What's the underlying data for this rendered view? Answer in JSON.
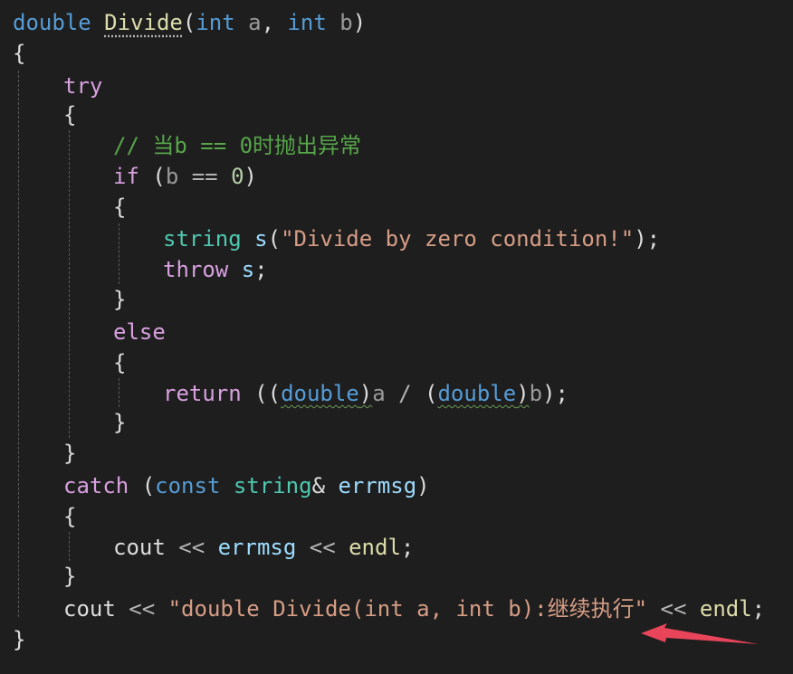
{
  "editor": {
    "code_lines": [
      [
        {
          "t": "double",
          "c": "kw"
        },
        {
          "t": " ",
          "c": "plain"
        },
        {
          "t": "Divide",
          "c": "fn",
          "u": "dotted"
        },
        {
          "t": "(",
          "c": "plain"
        },
        {
          "t": "int",
          "c": "kw"
        },
        {
          "t": " ",
          "c": "plain"
        },
        {
          "t": "a",
          "c": "par"
        },
        {
          "t": ", ",
          "c": "plain"
        },
        {
          "t": "int",
          "c": "kw"
        },
        {
          "t": " ",
          "c": "plain"
        },
        {
          "t": "b",
          "c": "par"
        },
        {
          "t": ")",
          "c": "plain"
        }
      ],
      [
        {
          "t": "{",
          "c": "plain"
        }
      ],
      [
        {
          "t": "try",
          "c": "ctl"
        }
      ],
      [
        {
          "t": "{",
          "c": "plain"
        }
      ],
      [
        {
          "t": "// 当b == 0时抛出异常",
          "c": "cmt"
        }
      ],
      [
        {
          "t": "if",
          "c": "ctl"
        },
        {
          "t": " (",
          "c": "plain"
        },
        {
          "t": "b",
          "c": "par"
        },
        {
          "t": " == ",
          "c": "op"
        },
        {
          "t": "0",
          "c": "num"
        },
        {
          "t": ")",
          "c": "plain"
        }
      ],
      [
        {
          "t": "{",
          "c": "plain"
        }
      ],
      [
        {
          "t": "string",
          "c": "typ"
        },
        {
          "t": " ",
          "c": "plain"
        },
        {
          "t": "s",
          "c": "var"
        },
        {
          "t": "(",
          "c": "plain"
        },
        {
          "t": "\"Divide by zero condition!\"",
          "c": "str"
        },
        {
          "t": ");",
          "c": "plain"
        }
      ],
      [
        {
          "t": "throw",
          "c": "ctl"
        },
        {
          "t": " ",
          "c": "plain"
        },
        {
          "t": "s",
          "c": "var"
        },
        {
          "t": ";",
          "c": "plain"
        }
      ],
      [
        {
          "t": "}",
          "c": "plain"
        }
      ],
      [
        {
          "t": "else",
          "c": "ctl"
        }
      ],
      [
        {
          "t": "{",
          "c": "plain"
        }
      ],
      [
        {
          "t": "return",
          "c": "ctl"
        },
        {
          "t": " ((",
          "c": "plain"
        },
        {
          "t": "double",
          "c": "kw",
          "u": "squiggle"
        },
        {
          "t": ")",
          "c": "plain",
          "u": "squiggle"
        },
        {
          "t": "a",
          "c": "par"
        },
        {
          "t": " / ",
          "c": "op"
        },
        {
          "t": "(",
          "c": "plain"
        },
        {
          "t": "double",
          "c": "kw",
          "u": "squiggle"
        },
        {
          "t": ")",
          "c": "plain",
          "u": "squiggle"
        },
        {
          "t": "b",
          "c": "par"
        },
        {
          "t": ");",
          "c": "plain"
        }
      ],
      [
        {
          "t": "}",
          "c": "plain"
        }
      ],
      [
        {
          "t": "}",
          "c": "plain"
        }
      ],
      [
        {
          "t": "catch",
          "c": "ctl"
        },
        {
          "t": " (",
          "c": "plain"
        },
        {
          "t": "const",
          "c": "kw"
        },
        {
          "t": " ",
          "c": "plain"
        },
        {
          "t": "string",
          "c": "typ"
        },
        {
          "t": "& ",
          "c": "plain"
        },
        {
          "t": "errmsg",
          "c": "var"
        },
        {
          "t": ")",
          "c": "plain"
        }
      ],
      [
        {
          "t": "{",
          "c": "plain"
        }
      ],
      [
        {
          "t": "cout",
          "c": "plain"
        },
        {
          "t": " << ",
          "c": "op"
        },
        {
          "t": "errmsg",
          "c": "var"
        },
        {
          "t": " << ",
          "c": "op"
        },
        {
          "t": "endl",
          "c": "fn"
        },
        {
          "t": ";",
          "c": "plain"
        }
      ],
      [
        {
          "t": "}",
          "c": "plain"
        }
      ],
      [
        {
          "t": "cout",
          "c": "plain"
        },
        {
          "t": " << ",
          "c": "op"
        },
        {
          "t": "\"double Divide(int a, int b):继续执行\"",
          "c": "str"
        },
        {
          "t": " << ",
          "c": "op"
        },
        {
          "t": "endl",
          "c": "fn"
        },
        {
          "t": ";",
          "c": "plain"
        }
      ],
      [
        {
          "t": "}",
          "c": "plain"
        }
      ]
    ],
    "colors": {
      "background": "#1e1e1e",
      "keyword": "#569cd6",
      "control": "#d8a0df",
      "function": "#dcdcaa",
      "parameter": "#9a9a9a",
      "variable": "#9cdcfe",
      "type": "#4ec9b0",
      "string": "#d69d85",
      "number": "#b5cea8",
      "comment": "#57a64a",
      "annotation_arrow": "#e8445a"
    },
    "annotation": {
      "icon": "arrow-icon"
    }
  }
}
